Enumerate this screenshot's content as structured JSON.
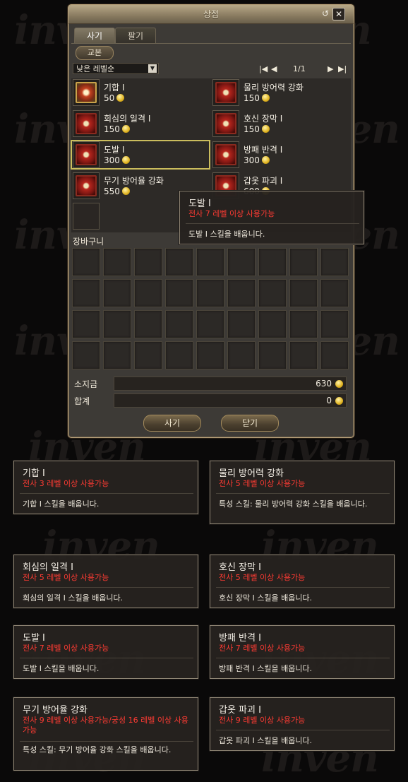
{
  "watermark": {
    "word": "inven",
    "url": "www.inven.co.kr"
  },
  "window": {
    "title": "상점",
    "refresh_icon": "↺",
    "close_icon": "✕",
    "tabs": [
      "사기",
      "팔기"
    ],
    "category": "교본",
    "sort": {
      "selected": "낮은 레벨순"
    },
    "pager": {
      "first": "|◀",
      "prev": "◀",
      "page": "1/1",
      "next": "▶",
      "last": "▶|"
    },
    "items": [
      {
        "name": "기합 I",
        "price": "50"
      },
      {
        "name": "물리 방어력 강화",
        "price": "150"
      },
      {
        "name": "회심의 일격 I",
        "price": "150"
      },
      {
        "name": "호신 장막 I",
        "price": "150"
      },
      {
        "name": "도발 I",
        "price": "300"
      },
      {
        "name": "방패 반격 I",
        "price": "300"
      },
      {
        "name": "무기 방어율 강화",
        "price": "550"
      },
      {
        "name": "갑옷 파괴 I",
        "price": "600"
      }
    ],
    "cart_label": "장바구니",
    "money_label": "소지금",
    "money_value": "630",
    "total_label": "합계",
    "total_value": "0",
    "buy_button": "사기",
    "close_button": "닫기"
  },
  "hover_tooltip": {
    "name": "도발 I",
    "req": "전사 7 레벨 이상 사용가능",
    "desc": "도발 I 스킬을 배웁니다."
  },
  "tooltips": [
    {
      "name": "기합 I",
      "req": "전사 3 레벨 이상 사용가능",
      "desc": "기합 I 스킬을 배웁니다."
    },
    {
      "name": "물리 방어력 강화",
      "req": "전사 5 레벨 이상 사용가능",
      "desc": "특성 스킬: 물리 방어력 강화 스킬을 배웁니다."
    },
    {
      "name": "회심의 일격 I",
      "req": "전사 5 레벨 이상 사용가능",
      "desc": "회심의 일격 I 스킬을 배웁니다."
    },
    {
      "name": "호신 장막 I",
      "req": "전사 5 레벨 이상 사용가능",
      "desc": "호신 장막 I 스킬을 배웁니다."
    },
    {
      "name": "도발 I",
      "req": "전사 7 레벨 이상 사용가능",
      "desc": "도발 I 스킬을 배웁니다."
    },
    {
      "name": "방패 반격 I",
      "req": "전사 7 레벨 이상 사용가능",
      "desc": "방패 반격 I 스킬을 배웁니다."
    },
    {
      "name": "무기 방어율 강화",
      "req": "전사 9 레벨 이상 사용가능/궁성 16 레벨 이상 사용가능",
      "desc": "특성 스킬: 무기 방어율 강화 스킬을 배웁니다."
    },
    {
      "name": "갑옷 파괴 I",
      "req": "전사 9 레벨 이상 사용가능",
      "desc": "갑옷 파괴 I 스킬을 배웁니다."
    }
  ]
}
